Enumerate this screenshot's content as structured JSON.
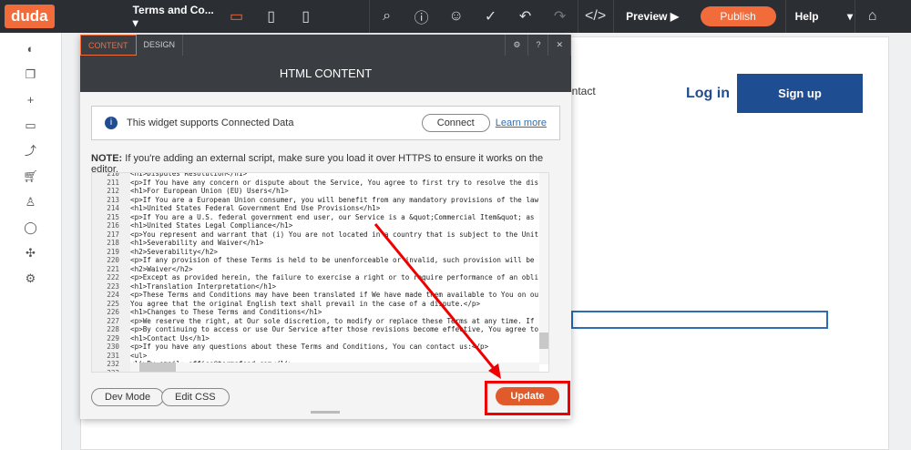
{
  "topbar": {
    "logo": "duda",
    "page": "Terms and Co...",
    "preview": "Preview ▶",
    "publish": "Publish",
    "help": "Help"
  },
  "site": {
    "contact": "ontact",
    "login": "Log in",
    "signup": "Sign up"
  },
  "dialog": {
    "tabs": [
      "CONTENT",
      "DESIGN"
    ],
    "title": "HTML CONTENT",
    "connected": "This widget supports Connected Data",
    "connect": "Connect",
    "learn": "Learn more",
    "note_label": "NOTE:",
    "note": " If you're adding an external script, make sure you load it over HTTPS to ensure it works on the editor.",
    "dev_mode": "Dev Mode",
    "edit_css": "Edit CSS",
    "update": "Update"
  },
  "code": [
    [
      "210",
      "<h1>Disputes Resolution</h1>"
    ],
    [
      "211",
      "<p>If You have any concern or dispute about the Service, You agree to first try to resolve the dis"
    ],
    [
      "212",
      "<h1>For European Union (EU) Users</h1>"
    ],
    [
      "213",
      "<p>If You are a European Union consumer, you will benefit from any mandatory provisions of the law"
    ],
    [
      "214",
      "<h1>United States Federal Government End Use Provisions</h1>"
    ],
    [
      "215",
      "<p>If You are a U.S. federal government end user, our Service is a &quot;Commercial Item&quot; as"
    ],
    [
      "216",
      "<h1>United States Legal Compliance</h1>"
    ],
    [
      "217",
      "<p>You represent and warrant that (i) You are not located in a country that is subject to the Unit"
    ],
    [
      "218",
      "<h1>Severability and Waiver</h1>"
    ],
    [
      "219",
      "<h2>Severability</h2>"
    ],
    [
      "220",
      "<p>If any provision of these Terms is held to be unenforceable or invalid, such provision will be"
    ],
    [
      "221",
      "<h2>Waiver</h2>"
    ],
    [
      "222",
      "<p>Except as provided herein, the failure to exercise a right or to require performance of an obli"
    ],
    [
      "223",
      "<h1>Translation Interpretation</h1>"
    ],
    [
      "224",
      "<p>These Terms and Conditions may have been translated if We have made them available to You on ou"
    ],
    [
      "225",
      "You agree that the original English text shall prevail in the case of a dispute.</p>"
    ],
    [
      "226",
      "<h1>Changes to These Terms and Conditions</h1>"
    ],
    [
      "227",
      "<p>We reserve the right, at Our sole discretion, to modify or replace these Terms at any time. If"
    ],
    [
      "228",
      "<p>By continuing to access or use Our Service after those revisions become effective, You agree to"
    ],
    [
      "229",
      "<h1>Contact Us</h1>"
    ],
    [
      "230",
      "<p>If you have any questions about these Terms and Conditions, You can contact us:</p>"
    ],
    [
      "231",
      "<ul>"
    ],
    [
      "232",
      "<li>By email: office@termsfeed.com</li>"
    ],
    [
      "233",
      ""
    ]
  ]
}
